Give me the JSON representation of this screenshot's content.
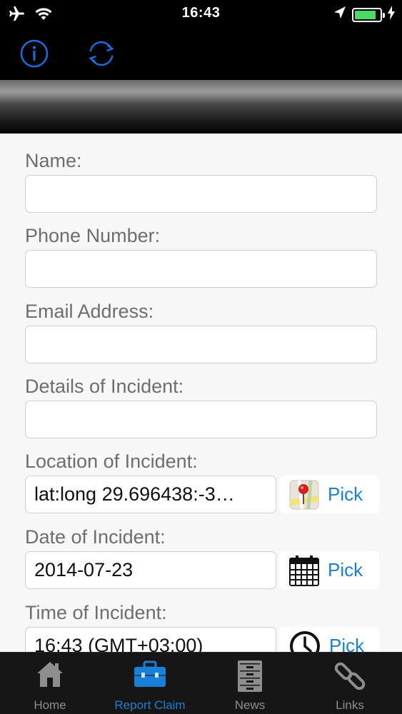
{
  "status_bar": {
    "time": "16:43",
    "icons": [
      "airplane-icon",
      "wifi-icon",
      "location-arrow-icon",
      "battery-icon",
      "charging-bolt-icon"
    ],
    "battery_level": 0.85,
    "battery_color": "#4cd964"
  },
  "toolbar": {
    "buttons": [
      "info-icon",
      "refresh-icon"
    ],
    "accent": "#1a6fe0"
  },
  "form": {
    "name_label": "Name:",
    "name_value": "",
    "phone_label": "Phone Number:",
    "phone_value": "",
    "email_label": "Email Address:",
    "email_value": "",
    "details_label": "Details of Incident:",
    "details_value": "",
    "location_label": "Location of Incident:",
    "location_value": "lat:long 29.696438:-3…",
    "location_pick": "Pick",
    "date_label": "Date of Incident:",
    "date_value": "2014-07-23",
    "date_pick": "Pick",
    "time_label": "Time of Incident:",
    "time_value": "16:43 (GMT+03:00)",
    "time_pick": "Pick"
  },
  "tab_bar": {
    "tabs": [
      {
        "label": "Home",
        "icon": "house-icon",
        "active": false
      },
      {
        "label": "Report Claim",
        "icon": "briefcase-icon",
        "active": true
      },
      {
        "label": "News",
        "icon": "filing-cabinet-icon",
        "active": false
      },
      {
        "label": "Links",
        "icon": "chain-link-icon",
        "active": false
      }
    ],
    "active_color": "#1a7fd6",
    "inactive_color": "#8e8e8e"
  }
}
